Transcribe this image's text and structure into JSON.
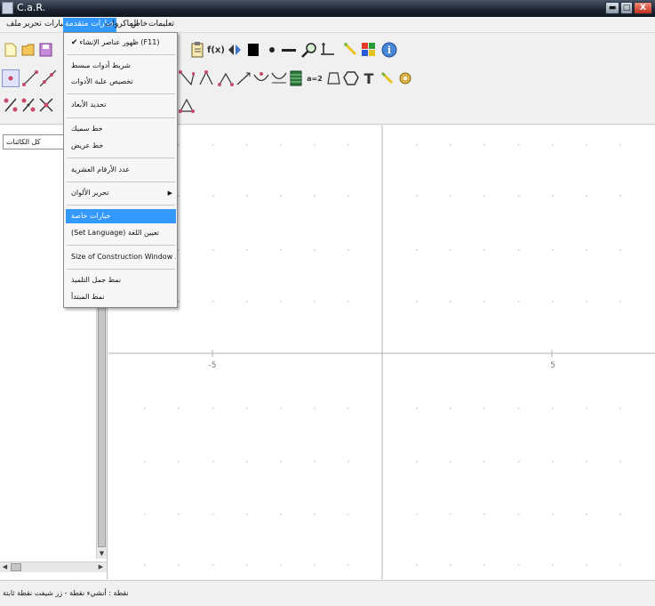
{
  "window": {
    "title": "C.a.R."
  },
  "window_buttons": {
    "minimize": "▬",
    "maximize": "□",
    "close": "X"
  },
  "menubar": {
    "items": [
      {
        "label": "ملف"
      },
      {
        "label": "تحرير"
      },
      {
        "label": "خيارات"
      },
      {
        "label": "خيارات متقدمة"
      },
      {
        "label": "الماكروات"
      },
      {
        "label": "خاص"
      },
      {
        "label": "تعليمات"
      }
    ]
  },
  "dropdown": {
    "items": [
      {
        "label": "ظهور عناصر الإنشاء (F11)",
        "check": "✔"
      },
      {
        "label": "شريط أدوات مبسط"
      },
      {
        "label": "تخصيص علبة الأدوات"
      },
      {
        "label": "تحديد الأبعاد"
      },
      {
        "label": "خط سميك"
      },
      {
        "label": "خط عريض"
      },
      {
        "label": "عدد الأرقام العشرية"
      },
      {
        "label": "تحرير الألوان",
        "submenu_arrow": "▶"
      },
      {
        "label": "خيارات خاصة"
      },
      {
        "label": "(Set Language) تعيين اللغة"
      },
      {
        "label": "Size of Construction Window ..."
      },
      {
        "label": "نمط جمل التلميذ"
      },
      {
        "label": "نمط المبتدأ"
      }
    ]
  },
  "left_panel": {
    "object_filter": "كل الكائنات",
    "scroll_arrows": {
      "down": "▼",
      "left": "◀",
      "right": "▶"
    }
  },
  "canvas": {
    "axis_labels": [
      "-5",
      "5"
    ],
    "colors": {
      "axis": "#b0b0b0",
      "grid_dot": "#c8c8c8"
    }
  },
  "status": {
    "text": "نقطة : أنشيء نقطة - زر شيفت نقطة ثابتة"
  },
  "toolbar": {
    "icons": [
      "new-file-icon",
      "open-file-icon",
      "save-icon",
      "clipboard-icon",
      "function-icon",
      "mirror-icon",
      "black-square-icon",
      "point-small-icon",
      "line-dash-icon",
      "zoom-icon",
      "axis-icon",
      "pencil-color-icon",
      "color-grid-icon",
      "info-icon",
      "point-tool-icon",
      "segment-icon",
      "line-tool-icon",
      "angle-icon",
      "polygon-icon",
      "vector-icon",
      "curve-icon",
      "grid-tool-icon",
      "assignment-icon",
      "quad-icon",
      "circle-tool-icon",
      "text-icon",
      "wand-icon",
      "gear-icon",
      "percent-icon",
      "percent-double-icon",
      "cross-icon",
      "triangle-icon"
    ],
    "labels": {
      "function": "f(x)",
      "text_tool": "T",
      "info": "i",
      "assignment": "a=2"
    }
  }
}
